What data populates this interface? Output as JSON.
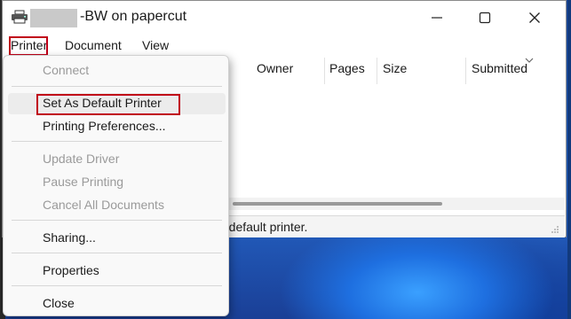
{
  "window": {
    "title_suffix": "-BW on papercut",
    "controls": {
      "minimize": "minimize",
      "maximize": "maximize",
      "close": "close"
    }
  },
  "menubar": {
    "printer": "Printer",
    "document": "Document",
    "view": "View"
  },
  "list": {
    "columns": [
      "Owner",
      "Pages",
      "Size",
      "Submitted"
    ]
  },
  "status": {
    "text": "e default printer."
  },
  "dropdown": {
    "items": [
      {
        "label": "Connect",
        "enabled": false
      },
      {
        "label": "Set As Default Printer",
        "enabled": true,
        "highlighted": true
      },
      {
        "label": "Printing Preferences...",
        "enabled": true
      },
      {
        "label": "Update Driver",
        "enabled": false
      },
      {
        "label": "Pause Printing",
        "enabled": false
      },
      {
        "label": "Cancel All Documents",
        "enabled": false
      },
      {
        "label": "Sharing...",
        "enabled": true
      },
      {
        "label": "Properties",
        "enabled": true
      },
      {
        "label": "Close",
        "enabled": true
      }
    ]
  },
  "colors": {
    "highlight_border": "#c00018",
    "disabled_text": "#9a9a9a"
  },
  "icons": {
    "app": "printer-icon",
    "sort": "chevron-down-icon"
  }
}
